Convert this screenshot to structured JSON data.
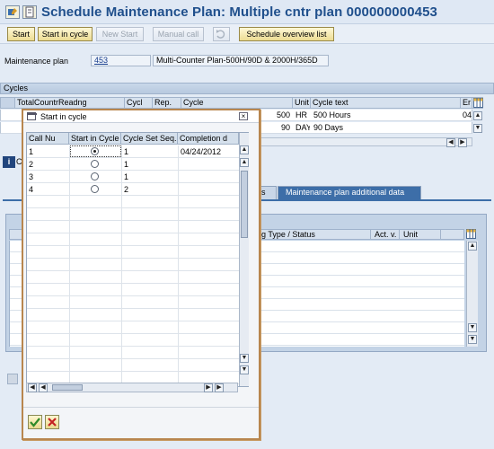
{
  "window": {
    "title": "Schedule Maintenance Plan: Multiple cntr plan 000000000453"
  },
  "toolbar": {
    "buttons": [
      {
        "label": "Start",
        "enabled": true
      },
      {
        "label": "Start in cycle",
        "enabled": true
      },
      {
        "label": "New Start",
        "enabled": false
      },
      {
        "label": "Manual call",
        "enabled": false
      },
      {
        "label": "Schedule overview list",
        "enabled": true
      }
    ]
  },
  "maintenance_plan": {
    "label": "Maintenance plan",
    "number": "453",
    "description": "Multi-Counter Plan-500H/90D & 2000H/365D"
  },
  "cycles": {
    "header": "Cycles",
    "columns": [
      "TotalCountrReadng",
      "Cycl",
      "Rep.",
      "Cycle",
      "Unit",
      "Cycle text",
      "Er"
    ],
    "rows": [
      {
        "cycle": "500",
        "unit": "HR",
        "text": "500 Hours",
        "er": "04"
      },
      {
        "cycle": "90",
        "unit": "DAY",
        "text": "90 Days",
        "er": ""
      }
    ]
  },
  "info_marker": "C",
  "tabs": {
    "partial": "s",
    "active": "Maintenance plan additional data"
  },
  "right_table": {
    "columns": [
      "g Type / Status",
      "Act. v.",
      "Unit"
    ]
  },
  "popup": {
    "title": "Start in cycle",
    "columns": [
      "Call Nu",
      "Start in Cycle",
      "Cycle Set Seq.",
      "Completion d"
    ],
    "rows": [
      {
        "call": "1",
        "selected": true,
        "seq": "1",
        "date": "04/24/2012"
      },
      {
        "call": "2",
        "selected": false,
        "seq": "1",
        "date": ""
      },
      {
        "call": "3",
        "selected": false,
        "seq": "1",
        "date": ""
      },
      {
        "call": "4",
        "selected": false,
        "seq": "2",
        "date": ""
      }
    ],
    "confirm_icon": "checkmark-icon",
    "cancel_icon": "cancel-icon"
  },
  "colors": {
    "title": "#1f4f8c",
    "popup_border": "#b8864e",
    "active_tab": "#3d6ea8"
  }
}
